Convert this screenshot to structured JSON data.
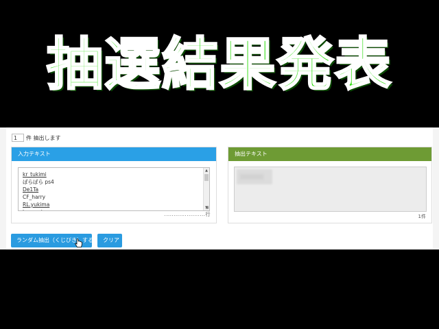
{
  "banner": {
    "title": "抽選結果発表"
  },
  "count": {
    "value": "1",
    "label": "件 抽出します"
  },
  "input_panel": {
    "title": "入力テキスト",
    "lines": [
      "kr_tukimi",
      "ぱらぱら ps4",
      "De1Ta",
      "CF_harry",
      "RL.yukima",
      "kucoooiyun"
    ],
    "line_count": "......................行"
  },
  "output_panel": {
    "title": "抽出テキスト",
    "result_count": "1件"
  },
  "buttons": {
    "draw": "ランダム抽出（くじびき）する",
    "clear": "クリア"
  },
  "colors": {
    "banner_text": "#22dd00",
    "input_header": "#2aa0e6",
    "output_header": "#6e9b34",
    "button": "#2a9be0"
  }
}
